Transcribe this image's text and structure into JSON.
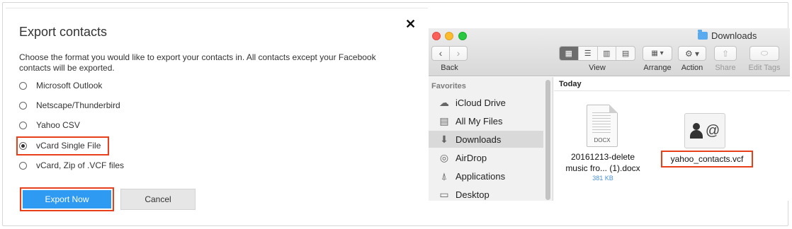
{
  "dialog": {
    "title": "Export contacts",
    "description": "Choose the format you would like to export your contacts in. All contacts except your Facebook contacts will be exported.",
    "options": [
      {
        "label": "Microsoft Outlook",
        "selected": false
      },
      {
        "label": "Netscape/Thunderbird",
        "selected": false
      },
      {
        "label": "Yahoo CSV",
        "selected": false
      },
      {
        "label": "vCard Single File",
        "selected": true
      },
      {
        "label": "vCard, Zip of .VCF files",
        "selected": false
      }
    ],
    "export_label": "Export Now",
    "cancel_label": "Cancel",
    "close_glyph": "✕",
    "accent": "#2e9af2",
    "highlight": "#e8401c"
  },
  "finder": {
    "title": "Downloads",
    "toolbar": {
      "back_label": "Back",
      "view_label": "View",
      "arrange_label": "Arrange",
      "action_label": "Action",
      "share_label": "Share",
      "edit_tags_label": "Edit Tags"
    },
    "sidebar": {
      "heading": "Favorites",
      "items": [
        {
          "label": "iCloud Drive",
          "icon": "cloud-icon",
          "selected": false
        },
        {
          "label": "All My Files",
          "icon": "files-icon",
          "selected": false
        },
        {
          "label": "Downloads",
          "icon": "download-icon",
          "selected": true
        },
        {
          "label": "AirDrop",
          "icon": "airdrop-icon",
          "selected": false
        },
        {
          "label": "Applications",
          "icon": "applications-icon",
          "selected": false
        },
        {
          "label": "Desktop",
          "icon": "desktop-icon",
          "selected": false
        }
      ]
    },
    "section": "Today",
    "files": [
      {
        "name": "20161213-delete music fro... (1).docx",
        "tag": "DOCX",
        "size": "381 KB"
      },
      {
        "name": "yahoo_contacts.vcf"
      }
    ]
  }
}
